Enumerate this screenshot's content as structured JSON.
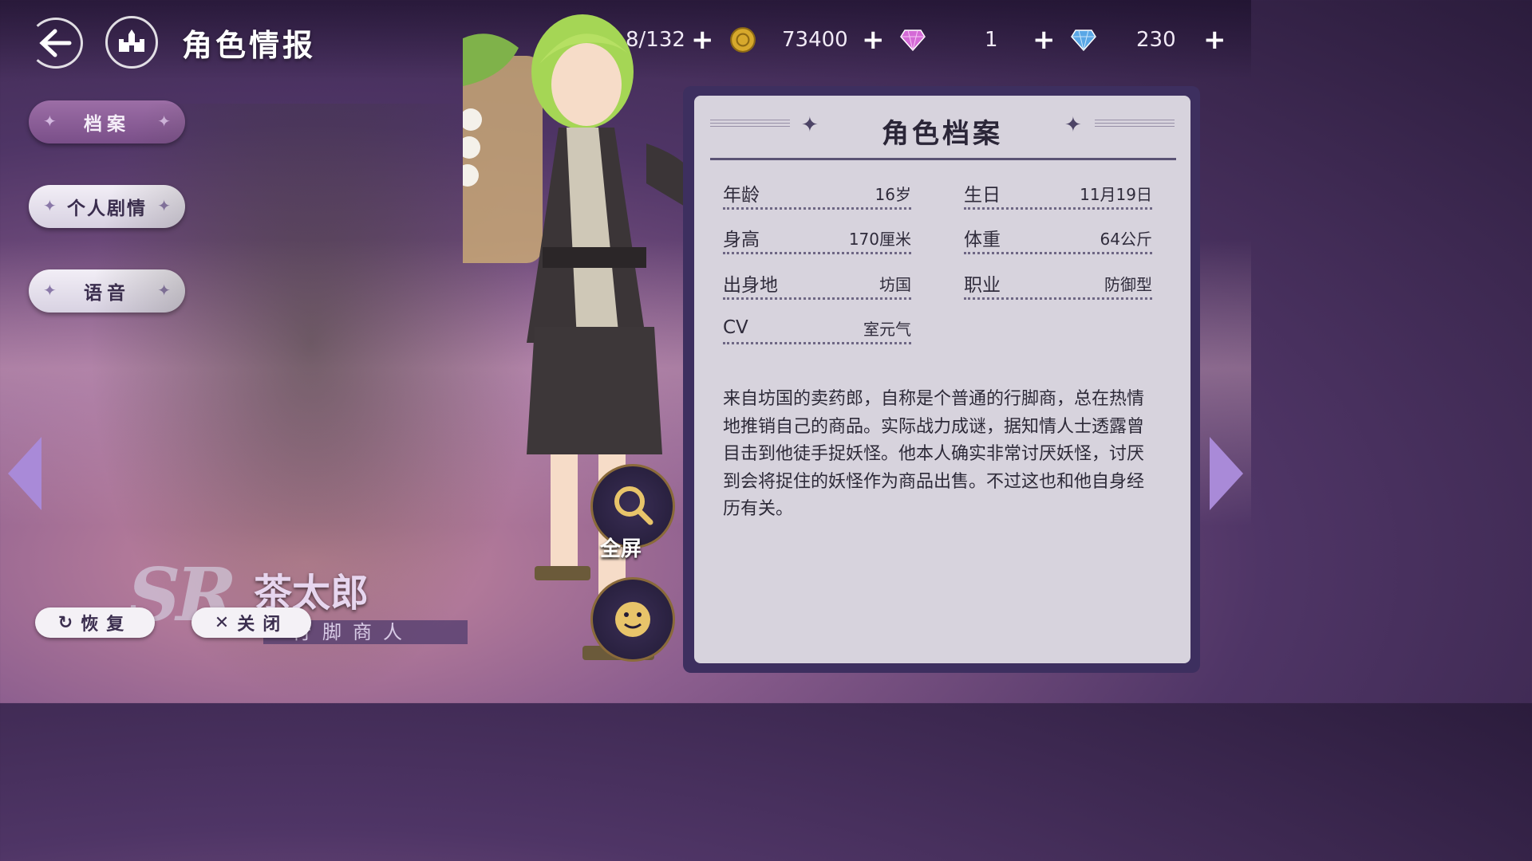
{
  "header": {
    "page_title": "角色情报",
    "resources": [
      {
        "name": "stamina",
        "value": "8/132",
        "icon": "stamina-icon"
      },
      {
        "name": "coins",
        "value": "73400",
        "icon": "coin-icon",
        "color": "#d7a92c"
      },
      {
        "name": "pink_gem",
        "value": "1",
        "icon": "pink-gem-icon",
        "color": "#d46ad6"
      },
      {
        "name": "blue_gem",
        "value": "230",
        "icon": "blue-gem-icon",
        "color": "#5aa7e6"
      }
    ]
  },
  "sidebar": {
    "items": [
      {
        "label": "档案",
        "active": true
      },
      {
        "label": "个人剧情",
        "active": false
      },
      {
        "label": "语音",
        "active": false
      }
    ]
  },
  "character": {
    "rarity": "SR",
    "name": "茶太郎",
    "title": "行脚商人"
  },
  "actions": {
    "fullscreen_label": "全屏",
    "restore_label": "恢复",
    "close_label": "关闭"
  },
  "profile": {
    "title": "角色档案",
    "stats": [
      {
        "label": "年龄",
        "value": "16岁"
      },
      {
        "label": "生日",
        "value": "11月19日"
      },
      {
        "label": "身高",
        "value": "170厘米"
      },
      {
        "label": "体重",
        "value": "64公斤"
      },
      {
        "label": "出身地",
        "value": "坊国"
      },
      {
        "label": "职业",
        "value": "防御型"
      },
      {
        "label": "CV",
        "value": "室元气"
      }
    ],
    "description": "来自坊国的卖药郎，自称是个普通的行脚商，总在热情地推销自己的商品。实际战力成谜，据知情人士透露曾目击到他徒手捉妖怪。他本人确实非常讨厌妖怪，讨厌到会将捉住的妖怪作为商品出售。不过这也和他自身经历有关。"
  },
  "colors": {
    "panel_bg": "#d7d3dd",
    "panel_frame": "#3d2f5f",
    "accent": "#7a4f89",
    "hair": "#9ccf4a"
  }
}
